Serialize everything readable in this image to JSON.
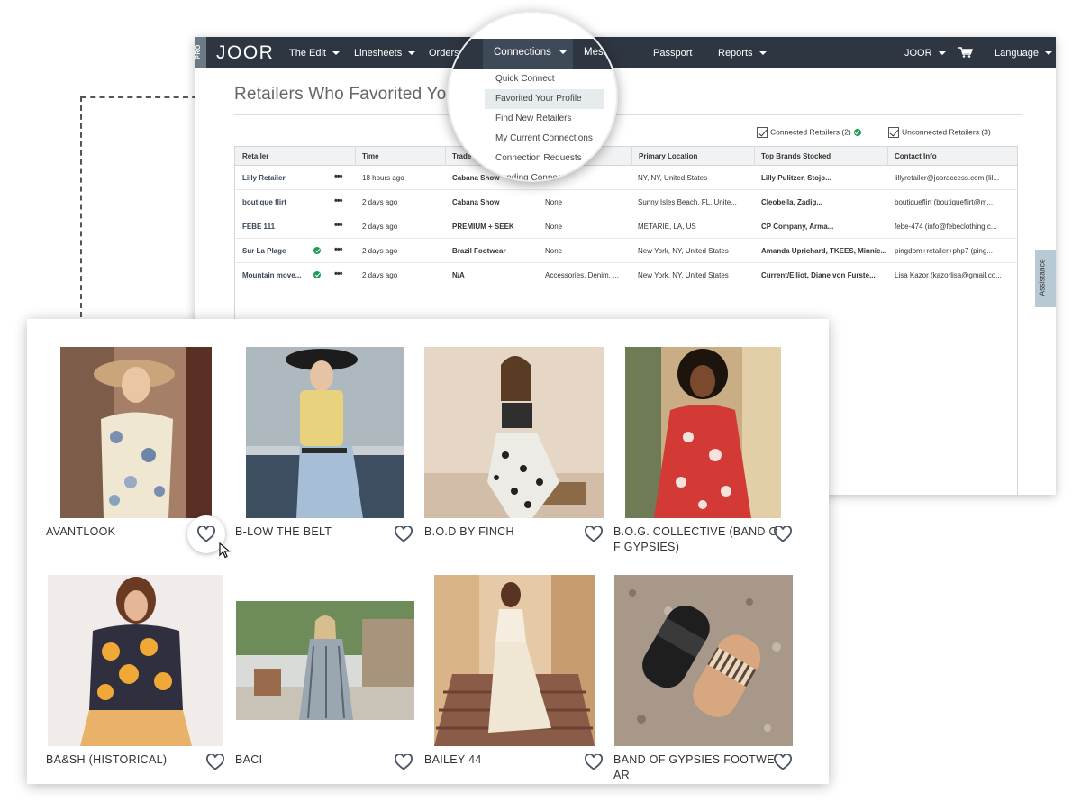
{
  "nav": {
    "pro": "PRO",
    "logo": "JOOR",
    "items": [
      "The Edit",
      "Linesheets",
      "Orders",
      "Connections",
      "Mess",
      "Passport",
      "Reports",
      "JOOR",
      "Language"
    ]
  },
  "page": {
    "title": "Retailers Who Favorited You",
    "filters": {
      "connected": "Connected Retailers (2)",
      "unconnected": "Unconnected Retailers (3)"
    }
  },
  "connections_menu": {
    "label": "Connections",
    "items": [
      "Quick Connect",
      "Favorited Your Profile",
      "Find New Retailers",
      "My Current Connections",
      "Connection Requests",
      "Pending Connections"
    ],
    "selected": "Favorited Your Profile"
  },
  "table": {
    "columns": [
      "Retailer",
      "Time",
      "Trade",
      "Primary Location",
      "Top Brands Stocked",
      "Contact Info"
    ],
    "rows": [
      {
        "retailer": "Lilly Retailer",
        "connected": false,
        "time": "18 hours ago",
        "trade": "Cabana Show",
        "category": "",
        "location": "NY, NY, United States",
        "brands": "Lilly Pulitzer, Stojo...",
        "contact": "lillyretailer@jooraccess.com (lil..."
      },
      {
        "retailer": "boutique flirt",
        "connected": false,
        "time": "2 days ago",
        "trade": "Cabana Show",
        "category": "None",
        "location": "Sunny Isles Beach, FL, Unite...",
        "brands": "Cleobella, Zadig...",
        "contact": "boutiqueflirt (boutiqueflirt@m..."
      },
      {
        "retailer": "FEBE 111",
        "connected": false,
        "time": "2 days ago",
        "trade": "PREMIUM + SEEK",
        "category": "None",
        "location": "METARIE, LA, US",
        "brands": "CP Company, Arma...",
        "contact": "febe-474 (info@febeclothing.c..."
      },
      {
        "retailer": "Sur La Plage",
        "connected": true,
        "time": "2 days ago",
        "trade": "Brazil Footwear",
        "category": "None",
        "location": "New York, NY, United States",
        "brands": "Amanda Uprichard, TKEES, Minnie...",
        "contact": "pingdom+retailer+php7 (ping..."
      },
      {
        "retailer": "Mountain move...",
        "connected": true,
        "time": "2 days ago",
        "trade": "N/A",
        "category": "Accessories, Denim, ...",
        "location": "New York, NY, United States",
        "brands": "Current/Elliot, Diane von Furste...",
        "contact": "Lisa Kazor (kazorlisa@gmail.co..."
      }
    ]
  },
  "assistance": "Assistance",
  "brands": [
    {
      "name": "AVANTLOOK",
      "line2": ""
    },
    {
      "name": "B-LOW THE BELT",
      "line2": ""
    },
    {
      "name": "B.O.D BY FINCH",
      "line2": ""
    },
    {
      "name": "B.O.G. COLLECTIVE (BAND O",
      "line2": "F GYPSIES)"
    },
    {
      "name": "BA&SH (HISTORICAL)",
      "line2": ""
    },
    {
      "name": "BACI",
      "line2": ""
    },
    {
      "name": "BAILEY 44",
      "line2": ""
    },
    {
      "name": "BAND OF GYPSIES FOOTWE",
      "line2": "AR"
    }
  ],
  "colors": {
    "nav_bg": "#2e3642",
    "heart": "#4a5566",
    "connected_badge": "#1f9a57"
  }
}
